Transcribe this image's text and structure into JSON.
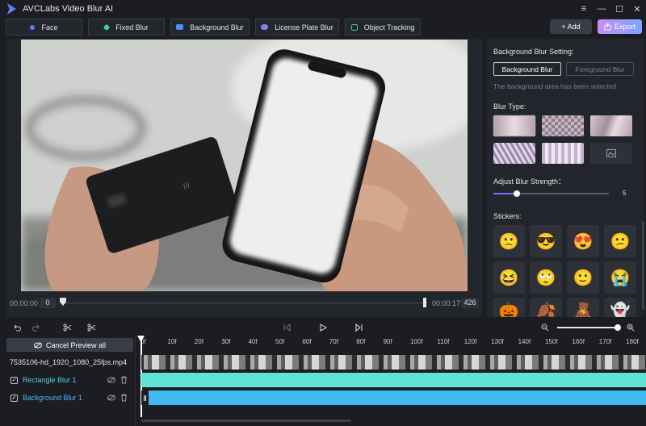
{
  "app": {
    "title": "AVCLabs Video Blur AI"
  },
  "window": {
    "menu": "≡",
    "minimize": "—",
    "maximize": "☐",
    "close": "✕"
  },
  "toolbar": {
    "tabs": [
      {
        "label": "Face",
        "color": "#5b7cff"
      },
      {
        "label": "Fixed Blur",
        "color": "#3fd4a4"
      },
      {
        "label": "Background Blur",
        "color": "#4f8cff"
      },
      {
        "label": "License Plate Blur",
        "color": "#8a7bff"
      },
      {
        "label": "Object Tracking",
        "color": "#2fd1a0"
      }
    ],
    "add_label": "+ Add",
    "export_label": "Export"
  },
  "preview": {
    "time_start": "00:00:00",
    "frame_start": "0",
    "time_end": "00:00:17",
    "frame_end": "426",
    "playhead_fraction": 0.0
  },
  "panel": {
    "setting_title": "Background Blur Setting:",
    "bg_blur_btn": "Background Blur",
    "fg_blur_btn": "Foreground Blur",
    "hint": "The background area has been selected",
    "blur_type_title": "Blur Type:",
    "strength_title": "Adjust Blur Strength：",
    "strength_value": "5",
    "strength_fraction": 0.2,
    "stickers_title": "Stickers:",
    "stickers": [
      "🙁",
      "😎",
      "😍",
      "😕",
      "😆",
      "🙄",
      "🙂",
      "😭",
      "🎃",
      "🍂",
      "🧸",
      "👻"
    ]
  },
  "timeline": {
    "cancel_preview": "Cancel Preview all",
    "file_name": "7535106-hd_1920_1080_25fps.mp4",
    "tracks": [
      {
        "label": "Rectangle Blur 1",
        "color": "#5ee3d6"
      },
      {
        "label": "Background Blur 1",
        "color": "#41b9f0"
      }
    ],
    "ruler": [
      "0f",
      "10f",
      "20f",
      "30f",
      "40f",
      "50f",
      "60f",
      "70f",
      "80f",
      "90f",
      "100f",
      "110f",
      "120f",
      "130f",
      "140f",
      "150f",
      "160f",
      "170f",
      "180f"
    ],
    "zoom_fraction": 0.99
  },
  "colors": {
    "accent": "#7aa7ff",
    "track1": "#5ee3d6",
    "track2": "#41b9f0",
    "active_label": "#4fd1e0"
  }
}
